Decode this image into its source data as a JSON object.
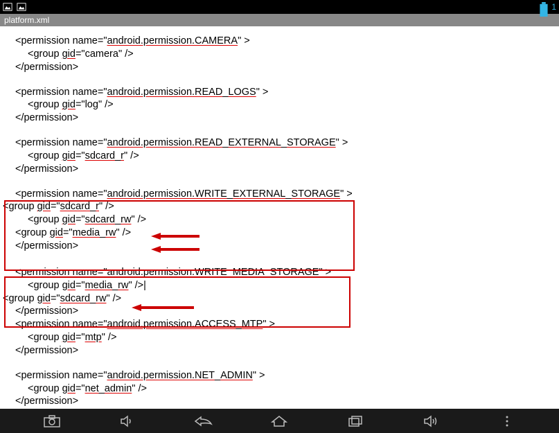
{
  "status": {
    "time": "1"
  },
  "title": "platform.xml",
  "perm": {
    "camera": {
      "name": "android.permission.CAMERA",
      "gid": "camera"
    },
    "read_logs": {
      "name": "android.permission.READ_LOGS",
      "gid": "log"
    },
    "read_ext": {
      "name": "android.permission.READ_EXTERNAL_STORAGE",
      "gid": "sdcard_r"
    },
    "write_ext": {
      "name": "android.permission.WRITE_EXTERNAL_STORAGE",
      "gid1": "sdcard_r",
      "gid2": "sdcard_rw",
      "gid3": "media_rw"
    },
    "write_media": {
      "name": "android.permission.WRITE_MEDIA_STORAGE",
      "gid1": "media_rw",
      "gid2": "sdcard_rw"
    },
    "access_mtp": {
      "name": "android.permission.ACCESS_MTP",
      "gid": "mtp"
    },
    "net_admin": {
      "name": "android.permission.NET_ADMIN",
      "gid": "net_admin"
    }
  },
  "xml": {
    "perm_open": "<permission name=\"",
    "perm_close_open": "\" >",
    "perm_end": "</permission>",
    "group_open": "<group ",
    "gid_attr": "gid",
    "eq": "=\"",
    "group_close": "\" />",
    "group_close_cursor": "\" />|",
    "lt_group": "<group "
  }
}
